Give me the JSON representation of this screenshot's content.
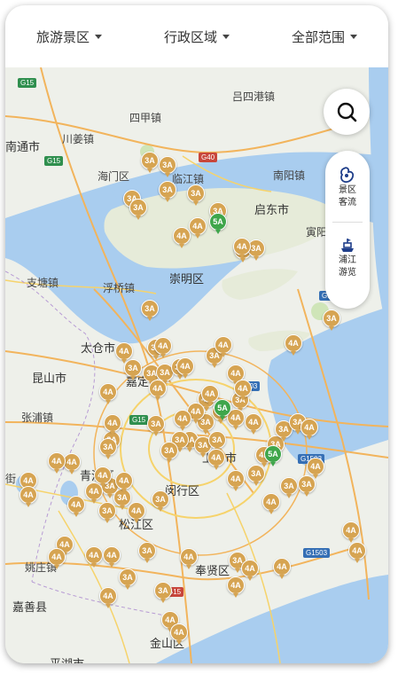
{
  "filters": {
    "scenic_type": "旅游景区",
    "district": "行政区域",
    "range": "全部范围"
  },
  "side_panel": {
    "flow_label": "景区客流",
    "cruise_label": "浦江游览"
  },
  "map": {
    "places": {
      "lvsigang": "吕四港镇",
      "siyangzhen": "四甲镇",
      "nantong": "南通市",
      "chuanjiang": "川姜镇",
      "haimen": "海门区",
      "linjiang": "临江镇",
      "nanyang": "南阳镇",
      "qidong": "启东市",
      "yinlong": "寅阳",
      "chongming": "崇明区",
      "zhitang": "支塘镇",
      "fuqiao": "浮桥镇",
      "taicang": "太仓市",
      "kunshan": "昆山市",
      "jiading": "嘉定区",
      "zhangpu": "张浦镇",
      "qingpu": "青浦区",
      "shanghai": "上海市",
      "minhang": "闵行区",
      "songjiang": "松江区",
      "fengxian": "奉贤区",
      "yaozhuang": "姚庄镇",
      "jiashan": "嘉善县",
      "jinshan": "金山区",
      "pinghu": "平湖市",
      "jie": "街"
    },
    "roads": {
      "g15_a": "G15",
      "g15_b": "G15",
      "g40": "G40",
      "g1503_a": "G1503",
      "g1503_b": "G1503",
      "g1503_c": "G1503",
      "g15_c": "G15",
      "g15_d": "G15",
      "s503": "503"
    },
    "markers_3a": [
      "3A",
      "3A",
      "3A",
      "3A",
      "3A",
      "3A",
      "3A",
      "3A",
      "3A",
      "3A",
      "3A",
      "3A",
      "3A",
      "3A",
      "3A",
      "3A",
      "3A",
      "3A",
      "3A",
      "3A",
      "3A",
      "3A",
      "3A",
      "3A",
      "3A",
      "3A",
      "3A",
      "3A",
      "3A",
      "3A",
      "3A",
      "3A",
      "3A",
      "3A",
      "3A",
      "3A",
      "3A",
      "3A",
      "3A",
      "3A",
      "3A",
      "3A"
    ],
    "markers_4a": [
      "4A",
      "4A",
      "4A",
      "4A",
      "4A",
      "4A",
      "4A",
      "4A",
      "4A",
      "4A",
      "4A",
      "4A",
      "4A",
      "4A",
      "4A",
      "4A",
      "4A",
      "4A",
      "4A",
      "4A",
      "4A",
      "4A",
      "4A",
      "4A",
      "4A",
      "4A",
      "4A",
      "4A",
      "4A",
      "4A",
      "4A",
      "4A",
      "4A",
      "4A",
      "4A",
      "4A",
      "4A",
      "4A",
      "4A"
    ],
    "markers_5a": [
      "5A",
      "5A",
      "5A"
    ]
  },
  "colors": {
    "water": "#a9cdef",
    "land": "#eef0ea",
    "marker_gold": "#d6a452",
    "marker_green": "#3fa64b",
    "road_orange": "#f2b45c",
    "road_yellow": "#f6d36b"
  }
}
